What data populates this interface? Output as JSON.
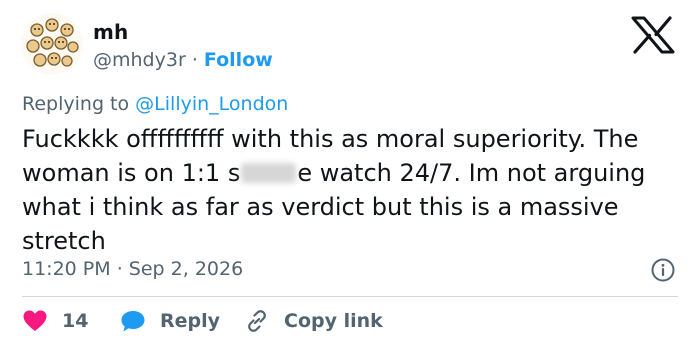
{
  "author": {
    "name": "mh",
    "handle": "@mhdy3r",
    "separator": "·",
    "follow_label": "Follow",
    "avatar_icon": "cartoon-avatar-icon"
  },
  "brand_icon": "x-logo-icon",
  "reply": {
    "prefix": "Replying to",
    "mention": "@Lillyin_London"
  },
  "tweet": {
    "text_before": "Fuckkkk offffffffff with this as moral superiority. The woman is on 1:1 s",
    "text_after": "e watch 24/7. Im not arguing what i think as far as verdict but this is a massive stretch"
  },
  "meta": {
    "time": "11:20 PM",
    "separator": "·",
    "date": "Sep 2, 2026",
    "info_icon": "info-icon"
  },
  "actions": {
    "like_count": "14",
    "reply_label": "Reply",
    "copy_label": "Copy link"
  },
  "colors": {
    "accent": "#1d9bf0",
    "like": "#f91880",
    "secondary_text": "#536471",
    "divider": "#cfd9de"
  }
}
